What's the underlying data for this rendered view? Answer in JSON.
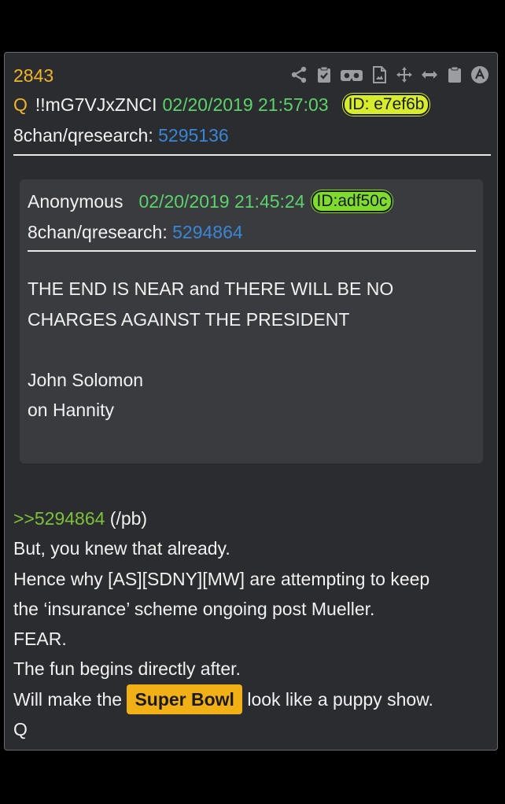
{
  "post": {
    "number": "2843",
    "author_letter": "Q",
    "tripcode": "!!mG7VJxZNCI",
    "date": "02/20/2019 21:57:03",
    "id_badge": "ID: e7ef6b",
    "board": "8chan/qresearch:",
    "board_post": "5295136"
  },
  "toolbar": {
    "icons": [
      "share-icon",
      "clipboard-check-icon",
      "vr-headset-icon",
      "document-image-icon",
      "move-icon",
      "expand-horizontal-icon",
      "clipboard-icon",
      "scroll-top-icon"
    ]
  },
  "quote": {
    "author": "Anonymous",
    "date": "02/20/2019 21:45:24",
    "id_badge": "ID:adf50c",
    "board": "8chan/qresearch:",
    "board_post": "5294864",
    "lines": [
      "THE END IS NEAR and THERE WILL BE NO",
      "CHARGES AGAINST THE PRESIDENT",
      "",
      "John Solomon",
      "on Hannity"
    ]
  },
  "body": {
    "ref": ">>5294864",
    "ref_suffix": " (/pb)",
    "line1": "But, you knew that already.",
    "line2": "Hence why [AS][SDNY][MW] are attempting to keep",
    "line3": "the ‘insurance’ scheme ongoing post Mueller.",
    "line4": "FEAR.",
    "line5": "The fun begins directly after.",
    "line6_pre": "Will make the ",
    "line6_highlight": "Super Bowl",
    "line6_post": " look like a puppy show.",
    "signature": "Q"
  },
  "colors": {
    "background": "#000000",
    "card": "#2b2c2f",
    "quote_box": "#3a3b3f",
    "accent_orange": "#f0b529",
    "date_green": "#5cd36a",
    "link_blue": "#3a86d6",
    "ref_green": "#7cc13a",
    "highlight": "#f1b116"
  }
}
